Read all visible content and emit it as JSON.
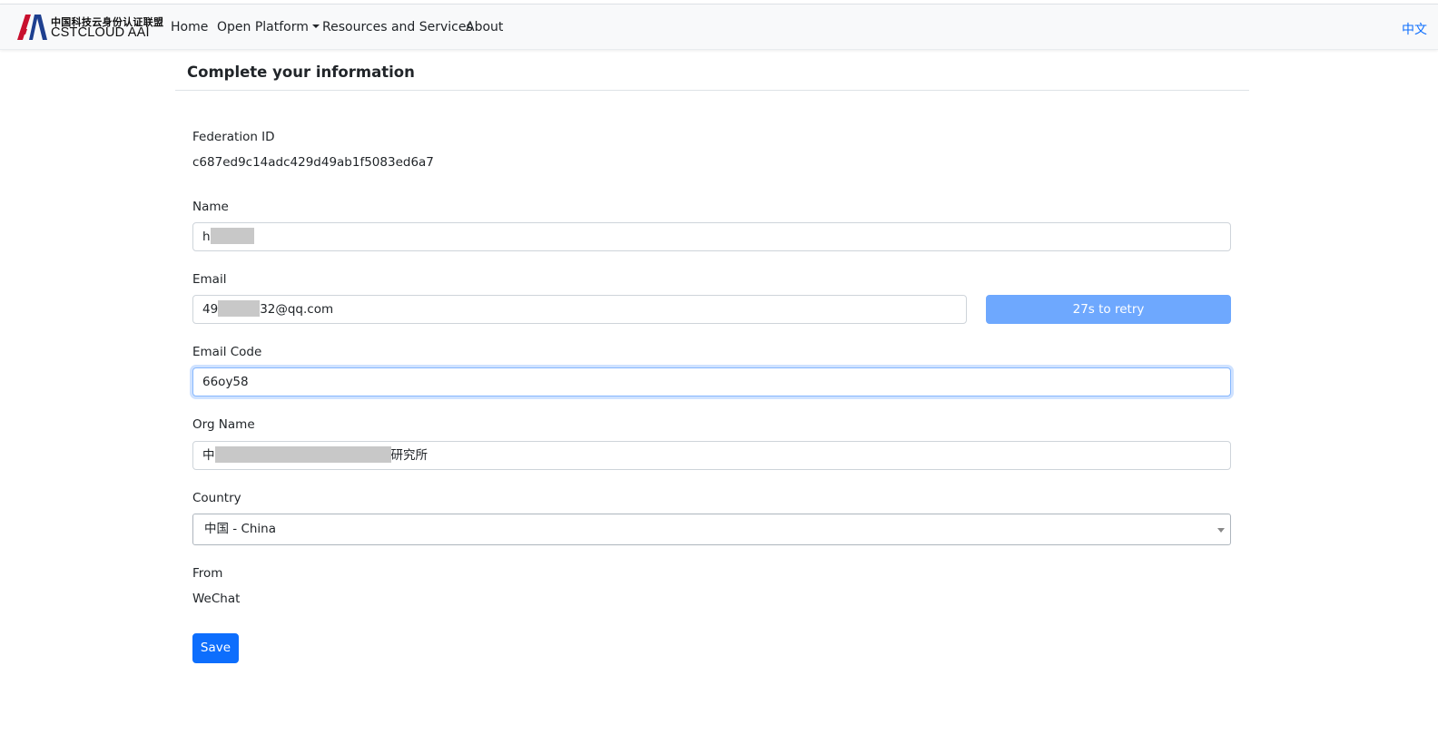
{
  "brand": {
    "title_cn": "中国科技云身份认证联盟",
    "title_en": "CSTCLOUD AAI",
    "logo_colors": [
      "#c8102e",
      "#1d3f8f"
    ]
  },
  "nav": {
    "items": [
      {
        "label": "Home"
      },
      {
        "label": "Open Platform",
        "has_dropdown": true
      },
      {
        "label": "Resources and Services"
      },
      {
        "label": "About"
      }
    ],
    "language_label": "中文"
  },
  "page": {
    "title": "Complete your information"
  },
  "form": {
    "federation_id": {
      "label": "Federation ID",
      "value": "c687ed9c14adc429d49ab1f5083ed6a7"
    },
    "name": {
      "label": "Name",
      "value_prefix": "h",
      "value_masked": true
    },
    "email": {
      "label": "Email",
      "value_prefix": "49",
      "value_suffix": "32@qq.com",
      "value_masked": true,
      "retry_label": "27s to retry"
    },
    "email_code": {
      "label": "Email Code",
      "value": "66oy58"
    },
    "org_name": {
      "label": "Org Name",
      "value_prefix": "中",
      "value_suffix": "研究所",
      "value_masked": true
    },
    "country": {
      "label": "Country",
      "selected": "中国 - China"
    },
    "from": {
      "label": "From",
      "value": "WeChat"
    },
    "save_label": "Save"
  },
  "colors": {
    "primary": "#0d6efd",
    "primary_disabled": "#6ea8fe",
    "navbar_bg": "#f8f9fa",
    "mask": "#c8c8c8"
  }
}
